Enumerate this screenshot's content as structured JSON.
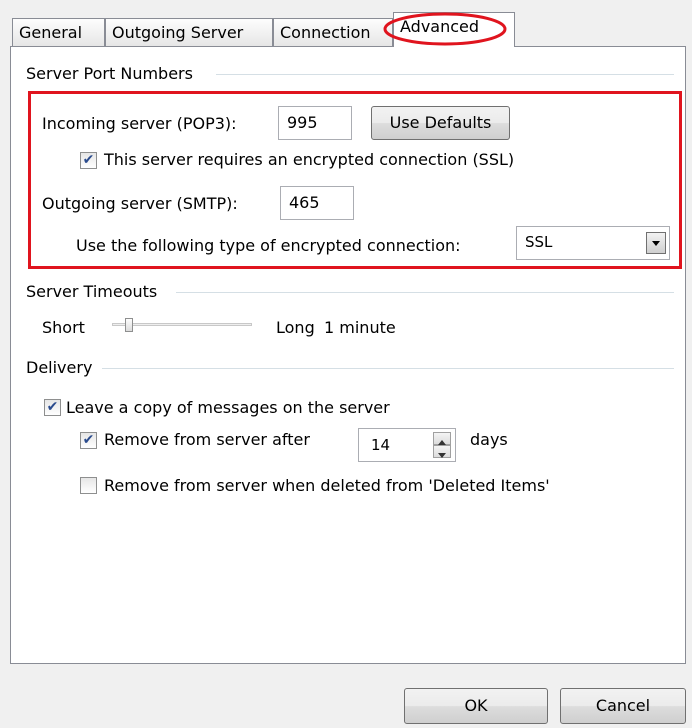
{
  "tabs": [
    {
      "label": "General"
    },
    {
      "label": "Outgoing Server"
    },
    {
      "label": "Connection"
    },
    {
      "label": "Advanced"
    }
  ],
  "server_ports": {
    "group_label": "Server Port Numbers",
    "incoming_label": "Incoming server (POP3):",
    "incoming_value": "995",
    "use_defaults_label": "Use Defaults",
    "ssl_required_label": "This server requires an encrypted connection (SSL)",
    "ssl_required_checked": true,
    "outgoing_label": "Outgoing server (SMTP):",
    "outgoing_value": "465",
    "encryption_label": "Use the following type of encrypted connection:",
    "encryption_value": "SSL"
  },
  "timeouts": {
    "group_label": "Server Timeouts",
    "short_label": "Short",
    "long_label": "Long",
    "value_label": "1 minute",
    "slider_level": 0.1
  },
  "delivery": {
    "group_label": "Delivery",
    "leave_copy_label": "Leave a copy of messages on the server",
    "leave_copy_checked": true,
    "remove_after_label": "Remove from server after",
    "remove_after_checked": true,
    "remove_after_value": "14",
    "days_label": "days",
    "remove_deleted_label": "Remove from server when deleted from 'Deleted Items'",
    "remove_deleted_checked": false
  },
  "footer": {
    "ok_label": "OK",
    "cancel_label": "Cancel"
  },
  "colors": {
    "highlight": "#e0141e"
  },
  "icons": {
    "check": "✔",
    "dropdown": "dropdown-arrow-icon",
    "spin_up": "spin-up-icon",
    "spin_down": "spin-down-icon"
  }
}
